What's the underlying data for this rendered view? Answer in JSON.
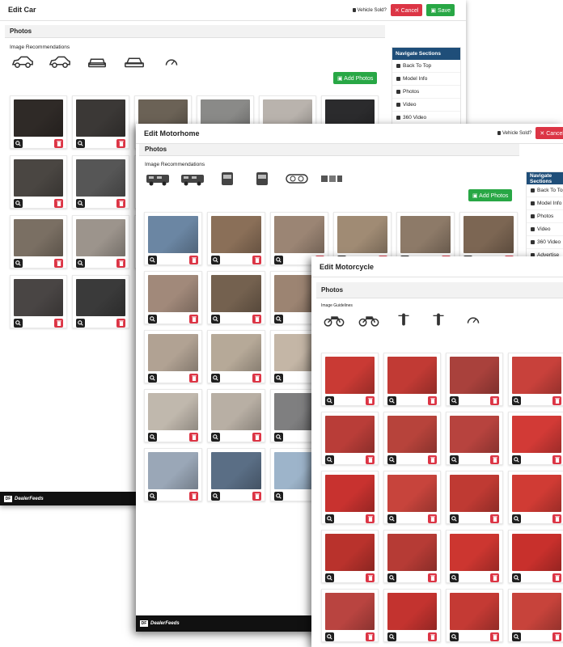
{
  "car": {
    "title": "Edit Car",
    "vehicle_sold": "Vehicle Sold?",
    "cancel_label": "✕ Cancel",
    "save_label": "▣ Save",
    "photos_title": "Photos",
    "recs_label": "Image Recommendations",
    "rec_icons": [
      "car-front-left-icon",
      "car-front-right-icon",
      "car-front-icon",
      "car-rear-icon",
      "speedometer-icon"
    ],
    "add_photos_label": "▣ Add Photos",
    "nav_title": "Navigate Sections",
    "nav_items": [
      "Back To Top",
      "Model Info",
      "Photos",
      "Video",
      "360 Video"
    ],
    "footer_logo": "DF",
    "footer_brand_a": "Dealer",
    "footer_brand_b": "Feeds",
    "photo_colors": [
      "#2f2a27",
      "#3b3836",
      "#6b6256",
      "#8a8a88",
      "#b9b3ad",
      "#2b2b2d",
      "#4a4642",
      "#565656",
      "#6f6a63",
      "#c9c2b6",
      "#3e3e3e",
      "#444",
      "#7a6f63",
      "#9c948c",
      "#d6d0c8",
      "#c7c2b9",
      "#6f6a66",
      "#2d3430",
      "#494544",
      "#3a3a3a"
    ]
  },
  "motorhome": {
    "title": "Edit Motorhome",
    "vehicle_sold": "Vehicle Sold?",
    "cancel_label": "✕ Cancel",
    "photos_title": "Photos",
    "recs_label": "Image Recommendations",
    "rec_icons": [
      "motorhome-side-left-icon",
      "motorhome-side-right-icon",
      "motorhome-front-icon",
      "motorhome-rear-icon",
      "dashboard-icon",
      "interior-icon"
    ],
    "add_photos_label": "▣ Add Photos",
    "nav_title": "Navigate Sections",
    "nav_items": [
      "Back To Top",
      "Model Info",
      "Photos",
      "Video",
      "360 Video",
      "Advertise"
    ],
    "footer_logo": "DF",
    "footer_brand_a": "Dealer",
    "footer_brand_b": "Feeds",
    "photo_colors": [
      "#6b86a3",
      "#8a6f58",
      "#9b8574",
      "#a08b74",
      "#8d7a68",
      "#7c6653",
      "#a1897a",
      "#74614f",
      "#9c8472",
      "#8e7d6d",
      "#c8bfb4",
      "#8a7565",
      "#b1a293",
      "#b6a998",
      "#c4b6a6",
      "#9a8a79",
      "#a9a197",
      "#a79b8e",
      "#c0b8ad",
      "#b8afa4",
      "#7f7f80",
      "#8b8278",
      "#707c8c",
      "#7f9ab2",
      "#9aa7b7",
      "#5a6e85",
      "#9db4ca",
      "#a7b2bd"
    ]
  },
  "motorcycle": {
    "title": "Edit Motorcycle",
    "photos_title": "Photos",
    "recs_label": "Image Guidelines",
    "rec_icons": [
      "motorcycle-side-left-icon",
      "motorcycle-side-right-icon",
      "motorcycle-front-icon",
      "motorcycle-rear-icon",
      "speedometer-icon"
    ],
    "photo_colors": [
      "#c93a34",
      "#c13a34",
      "#a9413c",
      "#c8413b",
      "#b93d38",
      "#b7433b",
      "#b7433e",
      "#d23a36",
      "#c8322f",
      "#c7443c",
      "#bf3a33",
      "#d03b34",
      "#b9322c",
      "#b63b35",
      "#cc3630",
      "#c8302c",
      "#b94440",
      "#c3332f",
      "#c43a34",
      "#c7433b"
    ]
  }
}
